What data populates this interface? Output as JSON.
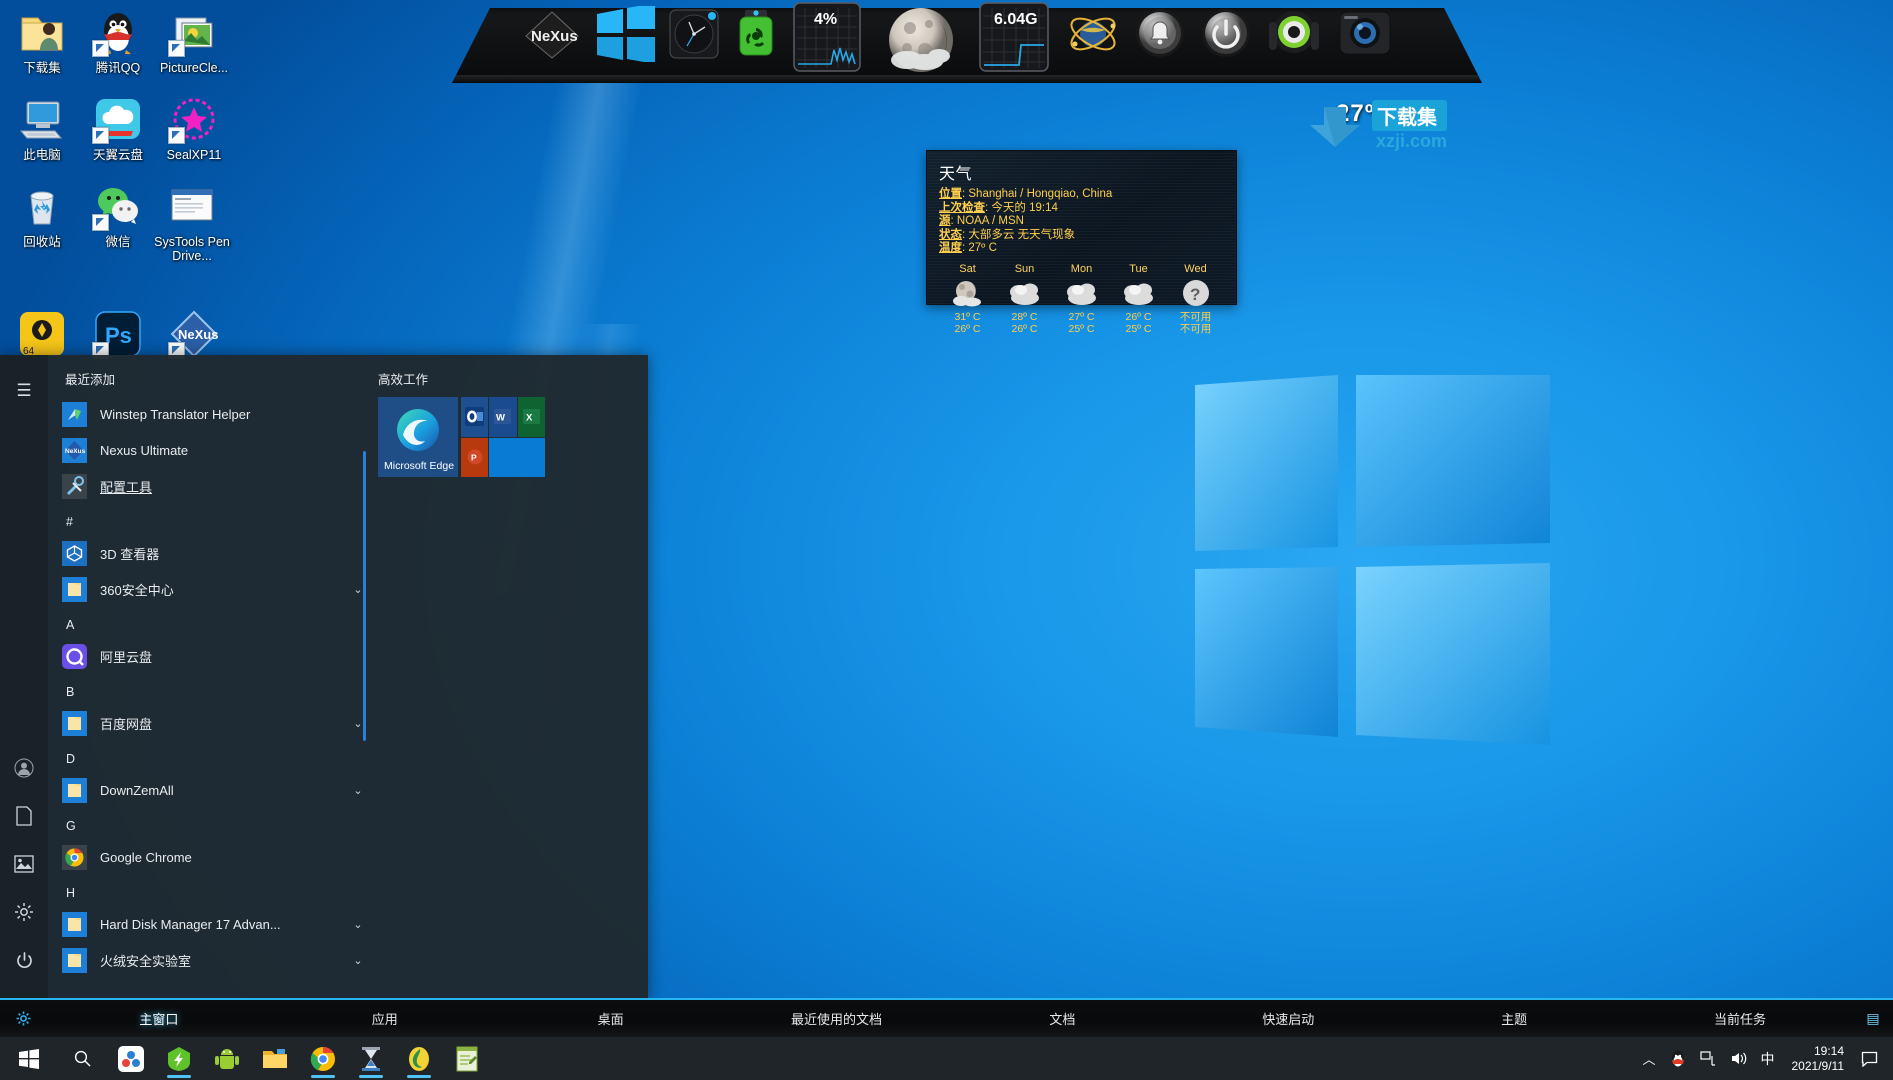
{
  "desktop": {
    "icons": [
      {
        "label": "下载集",
        "icon": "folder-user-icon",
        "shortcut": false,
        "col": 0,
        "row": 0
      },
      {
        "label": "腾讯QQ",
        "icon": "qq-penguin-icon",
        "shortcut": true,
        "col": 1,
        "row": 0
      },
      {
        "label": "PictureCle...",
        "icon": "picture-cleaner-icon",
        "shortcut": true,
        "col": 2,
        "row": 0
      },
      {
        "label": "此电脑",
        "icon": "this-pc-icon",
        "shortcut": false,
        "col": 0,
        "row": 1
      },
      {
        "label": "天翼云盘",
        "icon": "tianyi-cloud-icon",
        "shortcut": true,
        "col": 1,
        "row": 1
      },
      {
        "label": "SealXP11",
        "icon": "sealxp-icon",
        "shortcut": true,
        "col": 2,
        "row": 1
      },
      {
        "label": "回收站",
        "icon": "recycle-bin-icon",
        "shortcut": false,
        "col": 0,
        "row": 2
      },
      {
        "label": "微信",
        "icon": "wechat-icon",
        "shortcut": true,
        "col": 1,
        "row": 2
      },
      {
        "label": "SysTools Pen Drive...",
        "icon": "systools-pendrive-icon",
        "shortcut": false,
        "col": 2,
        "row": 2
      },
      {
        "label": "",
        "icon": "ida-pro-64-icon",
        "shortcut": false,
        "col": 0,
        "row": 3
      },
      {
        "label": "",
        "icon": "photoshop-icon",
        "shortcut": true,
        "col": 1,
        "row": 3
      },
      {
        "label": "",
        "icon": "nexus-icon",
        "shortcut": true,
        "col": 2,
        "row": 3
      }
    ]
  },
  "dock": {
    "name": "nexus-dock",
    "items": [
      {
        "name": "nexus-logo-icon",
        "label": "Nexus"
      },
      {
        "name": "windows-start-icon",
        "label": "Windows"
      },
      {
        "name": "clock-icon",
        "label": "Clock"
      },
      {
        "name": "biohazard-jar-icon",
        "label": "Recycler"
      },
      {
        "name": "cpu-meter-icon",
        "label": "CPU",
        "value": "4%"
      },
      {
        "name": "moon-weather-icon",
        "label": "Weather",
        "value": "27º C"
      },
      {
        "name": "memory-meter-icon",
        "label": "Memory",
        "value": "6.04G"
      },
      {
        "name": "network-globe-icon",
        "label": "Network"
      },
      {
        "name": "alarm-bell-icon",
        "label": "Alarm"
      },
      {
        "name": "power-button-icon",
        "label": "Power"
      },
      {
        "name": "headphones-icon",
        "label": "Audio"
      },
      {
        "name": "camera-icon",
        "label": "Camera"
      }
    ],
    "cpu_value": "4%",
    "memory_value": "6.04G",
    "temperature_label": "27º C"
  },
  "weather": {
    "title": "天气",
    "rows": [
      {
        "key": "位置",
        "value": "Shanghai / Hongqiao, China"
      },
      {
        "key": "上次检查",
        "value": "今天的 19:14"
      },
      {
        "key": "源",
        "value": "NOAA / MSN"
      },
      {
        "key": "状态",
        "value": "大部多云 无天气现象"
      },
      {
        "key": "温度",
        "value": "27º C"
      }
    ],
    "forecast": [
      {
        "day": "Sat",
        "icon": "moon-clouds-icon",
        "high": "31º C",
        "low": "26º C"
      },
      {
        "day": "Sun",
        "icon": "clouds-icon",
        "high": "28º C",
        "low": "26º C"
      },
      {
        "day": "Mon",
        "icon": "clouds-icon",
        "high": "27º C",
        "low": "25º C"
      },
      {
        "day": "Tue",
        "icon": "clouds-icon",
        "high": "26º C",
        "low": "25º C"
      },
      {
        "day": "Wed",
        "icon": "unknown-icon",
        "high": "不可用",
        "low": "不可用"
      }
    ]
  },
  "watermark": {
    "text1": "下载集",
    "text2": "xzji.com"
  },
  "start_menu": {
    "rail": [
      {
        "name": "hamburger-icon",
        "glyph": "≡"
      },
      {
        "name": "user-account-icon",
        "glyph": "◉"
      },
      {
        "name": "documents-icon",
        "glyph": "🗎"
      },
      {
        "name": "pictures-icon",
        "glyph": "🖻"
      },
      {
        "name": "settings-gear-icon",
        "glyph": "⚙"
      },
      {
        "name": "power-icon",
        "glyph": "⏻"
      }
    ],
    "recent_header": "最近添加",
    "recent_items": [
      {
        "label": "Winstep Translator Helper",
        "icon": "winstep-translator-icon",
        "chevron": false,
        "underline": false
      },
      {
        "label": "Nexus Ultimate",
        "icon": "nexus-ultimate-icon",
        "chevron": false,
        "underline": false
      },
      {
        "label": "配置工具",
        "icon": "config-tools-icon",
        "chevron": false,
        "underline": true
      }
    ],
    "groups": [
      {
        "letter": "#",
        "items": [
          {
            "label": "3D 查看器",
            "icon": "3d-viewer-icon",
            "chevron": false
          },
          {
            "label": "360安全中心",
            "icon": "folder-icon",
            "chevron": true
          }
        ]
      },
      {
        "letter": "A",
        "items": [
          {
            "label": "阿里云盘",
            "icon": "aliyun-drive-icon",
            "chevron": false
          }
        ]
      },
      {
        "letter": "B",
        "items": [
          {
            "label": "百度网盘",
            "icon": "folder-icon",
            "chevron": true
          }
        ]
      },
      {
        "letter": "D",
        "items": [
          {
            "label": "DownZemAll",
            "icon": "folder-icon",
            "chevron": true
          }
        ]
      },
      {
        "letter": "G",
        "items": [
          {
            "label": "Google Chrome",
            "icon": "chrome-icon",
            "chevron": false
          }
        ]
      },
      {
        "letter": "H",
        "items": [
          {
            "label": "Hard Disk Manager 17 Advan...",
            "icon": "folder-icon",
            "chevron": true
          },
          {
            "label": "火绒安全实验室",
            "icon": "folder-icon",
            "chevron": true
          }
        ]
      }
    ],
    "tiles_header": "高效工作",
    "tiles": {
      "edge": {
        "label": "Microsoft Edge",
        "icon": "edge-icon",
        "color": "#1f4e86"
      },
      "mini": [
        {
          "name": "outlook-tile",
          "color": "#1d4f91",
          "glyph": "O"
        },
        {
          "name": "word-tile",
          "color": "#1b4b8f",
          "glyph": "W"
        },
        {
          "name": "excel-tile",
          "color": "#0f6330",
          "glyph": "X"
        },
        {
          "name": "powerpoint-tile",
          "color": "#b8390e",
          "glyph": "P"
        },
        {
          "name": "empty-tile",
          "color": "#0a7bd4",
          "glyph": ""
        }
      ]
    }
  },
  "winstep_bar": {
    "gear_icon": "gear-icon",
    "tabs": [
      {
        "label": "主窗口",
        "active": true
      },
      {
        "label": "应用",
        "active": false
      },
      {
        "label": "桌面",
        "active": false
      },
      {
        "label": "最近使用的文档",
        "active": false
      },
      {
        "label": "文档",
        "active": false
      },
      {
        "label": "快速启动",
        "active": false
      },
      {
        "label": "主题",
        "active": false
      },
      {
        "label": "当前任务",
        "active": false
      }
    ]
  },
  "taskbar": {
    "start_icon": "windows-start-icon",
    "search_icon": "search-icon",
    "apps": [
      {
        "name": "tb-app-360",
        "active": false,
        "color": "#ffffff"
      },
      {
        "name": "tb-app-huorong",
        "active": true,
        "color": "#5fc22a"
      },
      {
        "name": "tb-app-android",
        "active": false,
        "color": "#9acd32"
      },
      {
        "name": "tb-app-explorer",
        "active": false,
        "color": "#ffcd57"
      },
      {
        "name": "tb-app-chrome",
        "active": true,
        "color": "#ea4335"
      },
      {
        "name": "tb-app-hourglass",
        "active": true,
        "color": "#d8d8d8"
      },
      {
        "name": "tb-app-thunder",
        "active": true,
        "color": "#f2d333"
      },
      {
        "name": "tb-app-notepad",
        "active": false,
        "color": "#bcd36b"
      }
    ],
    "tray": [
      {
        "name": "show-hidden-icons",
        "glyph": "︿"
      },
      {
        "name": "qq-tray-icon",
        "glyph": "🐧"
      },
      {
        "name": "network-tray-icon",
        "glyph": "🖧"
      },
      {
        "name": "volume-tray-icon",
        "glyph": "🔊"
      },
      {
        "name": "ime-tray-icon",
        "glyph": "中"
      }
    ],
    "clock": {
      "time": "19:14",
      "date": "2021/9/11"
    },
    "notification_icon": "action-center-icon"
  }
}
